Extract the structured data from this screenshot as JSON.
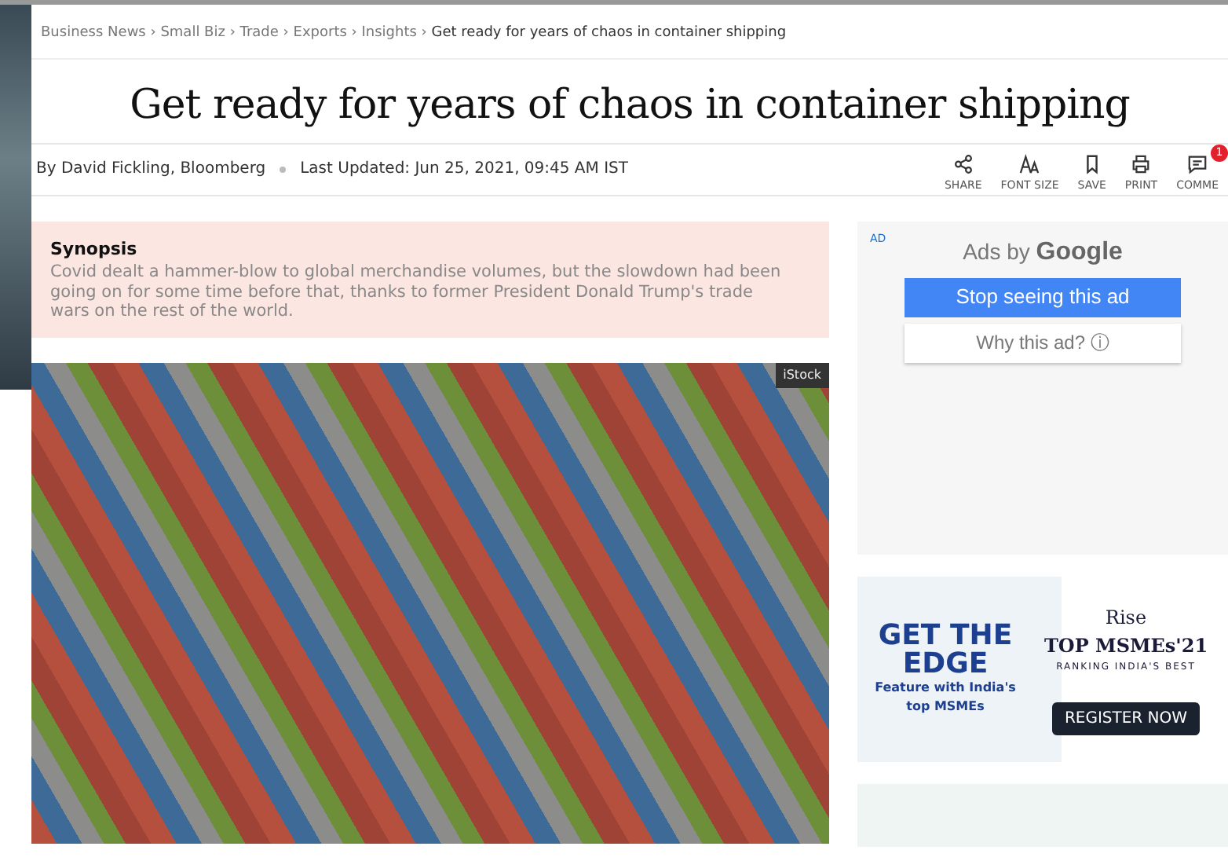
{
  "breadcrumbs": [
    {
      "label": "Business News",
      "current": false
    },
    {
      "label": "Small Biz",
      "current": false
    },
    {
      "label": "Trade",
      "current": false
    },
    {
      "label": "Exports",
      "current": false
    },
    {
      "label": "Insights",
      "current": false
    },
    {
      "label": "Get ready for years of chaos in container shipping",
      "current": true
    }
  ],
  "separator": "›",
  "headline": "Get ready for years of chaos in container shipping",
  "byline": "By David Fickling, Bloomberg",
  "updated": "Last Updated: Jun 25, 2021, 09:45 AM IST",
  "actions": [
    {
      "kind": "share",
      "label": "SHARE"
    },
    {
      "kind": "fontsize",
      "label": "FONT SIZE"
    },
    {
      "kind": "save",
      "label": "SAVE"
    },
    {
      "kind": "print",
      "label": "PRINT"
    },
    {
      "kind": "comment",
      "label": "COMME",
      "badge": "1"
    }
  ],
  "synopsis": {
    "title": "Synopsis",
    "text": "Covid dealt a hammer-blow to global merchandise volumes, but the slowdown had been going on for some time before that, thanks to former President Donald Trump's trade wars on the rest of the world."
  },
  "photo": {
    "credit": "iStock"
  },
  "ad": {
    "tag": "AD",
    "by": "Ads by",
    "brand": "Google",
    "stop": "Stop seeing this ad",
    "why": "Why this ad?",
    "info": "ⓘ"
  },
  "banner": {
    "headline": "GET THE EDGE",
    "sub": "Feature with India's top MSMEs",
    "brand": "Rise",
    "title": "TOP MSMEs'21",
    "tagline": "RANKING INDIA'S BEST",
    "cta": "REGISTER NOW"
  }
}
